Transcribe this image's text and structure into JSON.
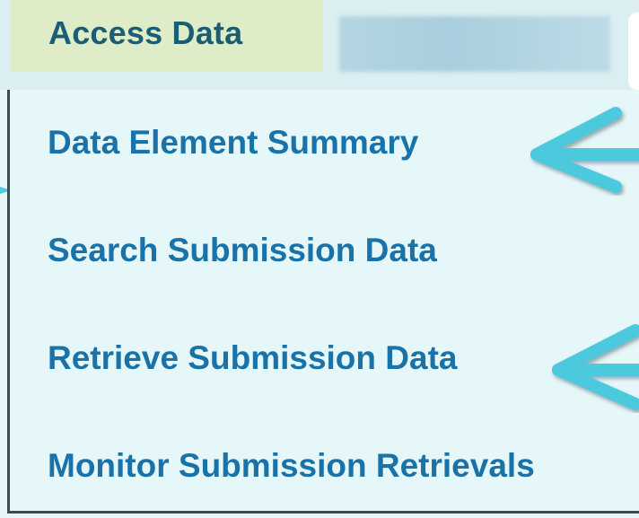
{
  "menu_bar": {
    "active_tab_label": "Access Data"
  },
  "dropdown": {
    "items": [
      {
        "label": "Data Element Summary"
      },
      {
        "label": "Search Submission Data"
      },
      {
        "label": "Retrieve Submission Data"
      },
      {
        "label": "Monitor Submission Retrievals"
      }
    ]
  },
  "annotations": {
    "arrow_color": "#4ec9de",
    "arrow_icon": "left-arrow-icon"
  },
  "colors": {
    "link_text": "#1a73a8",
    "tab_text": "#1b5e74",
    "active_tab_bg": "#dfecc8",
    "dropdown_bg": "#e6f7fa"
  }
}
